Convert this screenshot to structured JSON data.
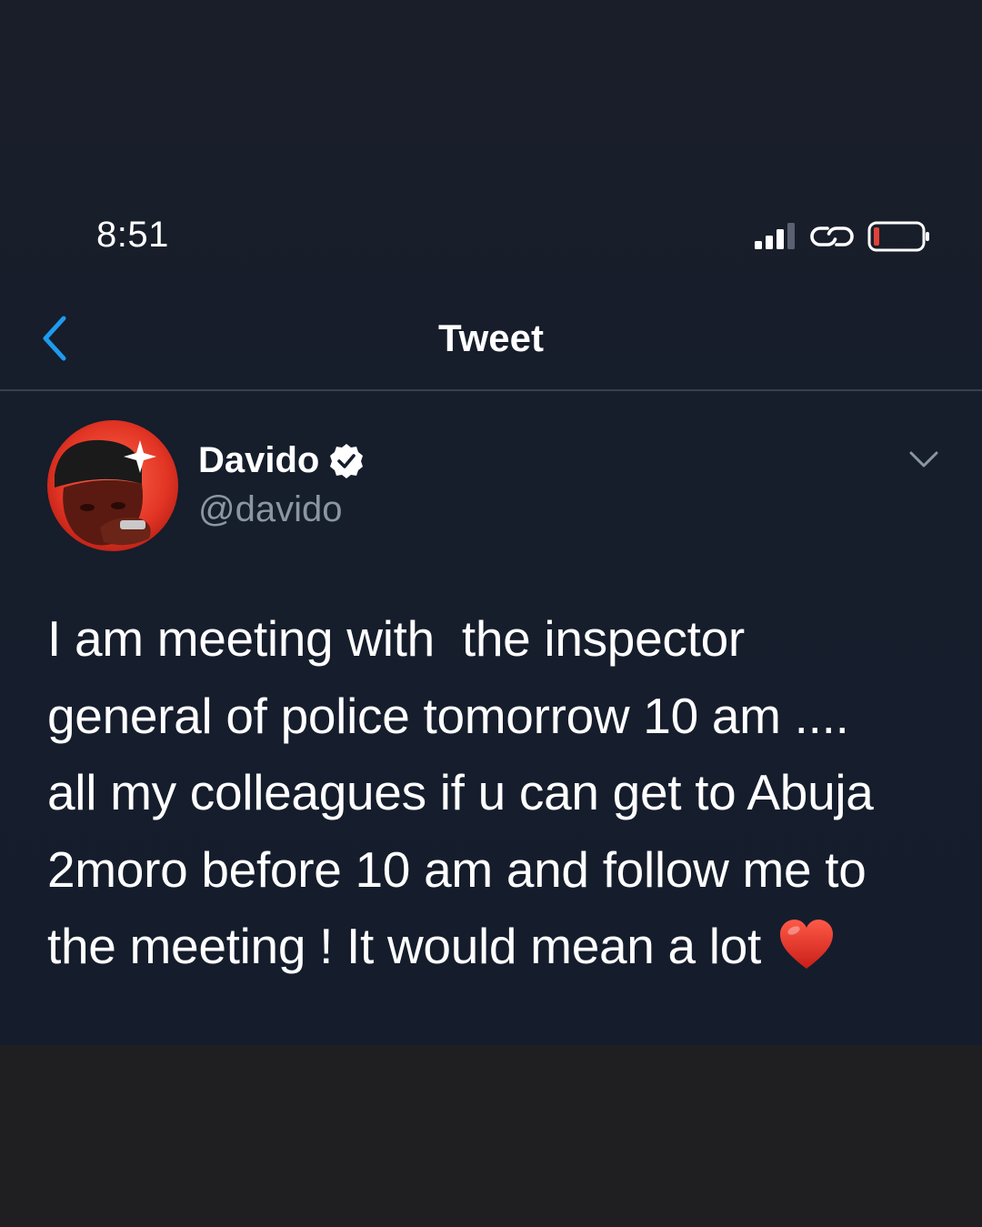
{
  "status_bar": {
    "time": "8:51",
    "signal_icon": "signal-bars-icon",
    "link_icon": "chain-link-icon",
    "battery_icon": "battery-low-icon"
  },
  "nav": {
    "back_icon": "chevron-left-icon",
    "title": "Tweet"
  },
  "tweet": {
    "author": {
      "name": "Davido",
      "handle": "@davido",
      "verified_icon": "verified-badge-icon"
    },
    "menu_icon": "chevron-down-icon",
    "text_lines": [
      "I am meeting with  the inspector",
      "general of police tomorrow 10 am ....",
      "all my colleagues if u can get to Abuja",
      "2moro before 10 am and follow me to",
      "the meeting ! It would mean a lot"
    ],
    "emoji": "red-heart-emoji"
  },
  "colors": {
    "background": "#161d2b",
    "accent": "#1d9bf0",
    "text_primary": "#ffffff",
    "text_secondary": "#8a96a3",
    "divider": "#38404c",
    "battery_low": "#e0433a",
    "heart": "#e0302a"
  }
}
